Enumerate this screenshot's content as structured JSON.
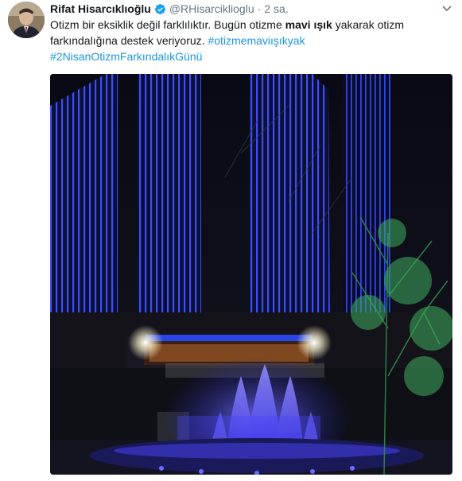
{
  "tweet": {
    "author_name": "Rifat Hisarcıklıoğlu",
    "author_handle": "@RHisarciklioglu",
    "separator": "·",
    "time": "2 sa.",
    "verified_icon": "verified-badge-icon",
    "menu_icon": "chevron-down-icon",
    "text_part1": "Otizm bir eksiklik değil farklılıktır.  Bugün otizme ",
    "text_bold": "mavi ışık",
    "text_part2": " yakarak otizm farkındalığına destek veriyoruz. ",
    "hashtag1": "#otizmemaviışıkyak",
    "hashtag2": "#2NisanOtizmFarkındalıkGünü",
    "media_alt_icon": "photo-media",
    "colors": {
      "text": "#14171a",
      "secondary": "#657786",
      "link": "#1b95e0",
      "verified": "#1da1f2"
    }
  }
}
